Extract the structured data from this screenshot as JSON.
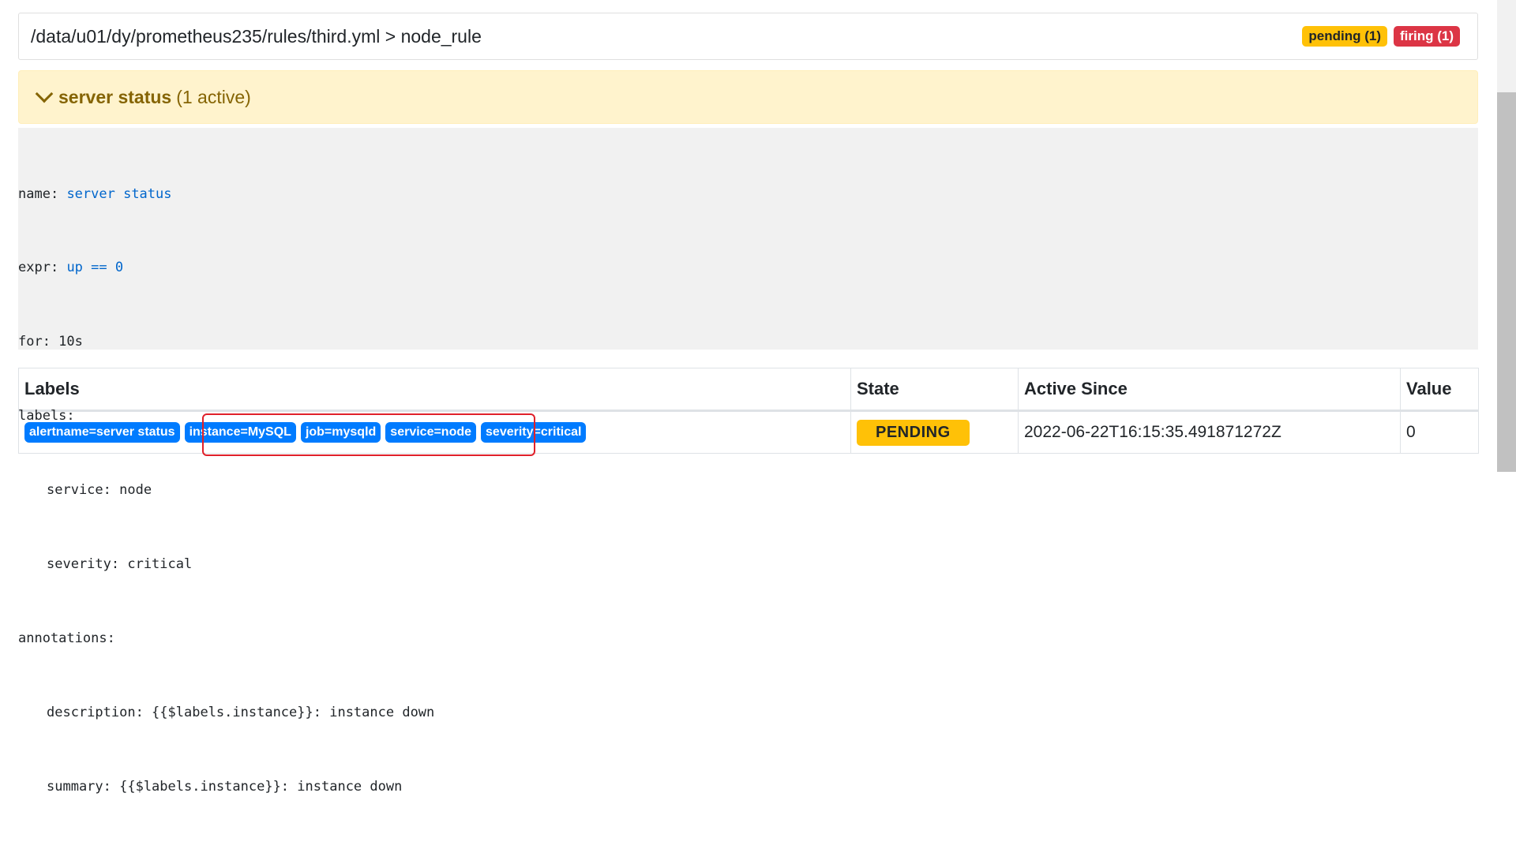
{
  "rule_group": {
    "path": "/data/u01/dy/prometheus235/rules/third.yml > node_rule",
    "badges": {
      "pending": "pending (1)",
      "firing": "firing (1)"
    }
  },
  "alert": {
    "name": "server status",
    "active": "(1 active)",
    "definition": {
      "name_key": "name:",
      "name_val": "server status",
      "expr_key": "expr:",
      "expr_val": "up == 0",
      "for_line": "for: 10s",
      "labels_key": "labels:",
      "service_line": "service: node",
      "severity_line": "severity: critical",
      "annotations_key": "annotations:",
      "description_line": "description: {{$labels.instance}}: instance down",
      "summary_line": "summary: {{$labels.instance}}: instance down"
    }
  },
  "table": {
    "headers": {
      "labels": "Labels",
      "state": "State",
      "active_since": "Active Since",
      "value": "Value"
    },
    "rows": [
      {
        "labels": [
          "alertname=server status",
          "instance=MySQL",
          "job=mysqld",
          "service=node",
          "severity=critical"
        ],
        "state": "PENDING",
        "active_since": "2022-06-22T16:15:35.491871272Z",
        "value": "0"
      }
    ]
  },
  "colors": {
    "pending": "#ffc107",
    "firing": "#dc3545",
    "label_badge": "#007bff",
    "alert_bg": "#fff3cd",
    "highlight_box": "#e0202a"
  }
}
